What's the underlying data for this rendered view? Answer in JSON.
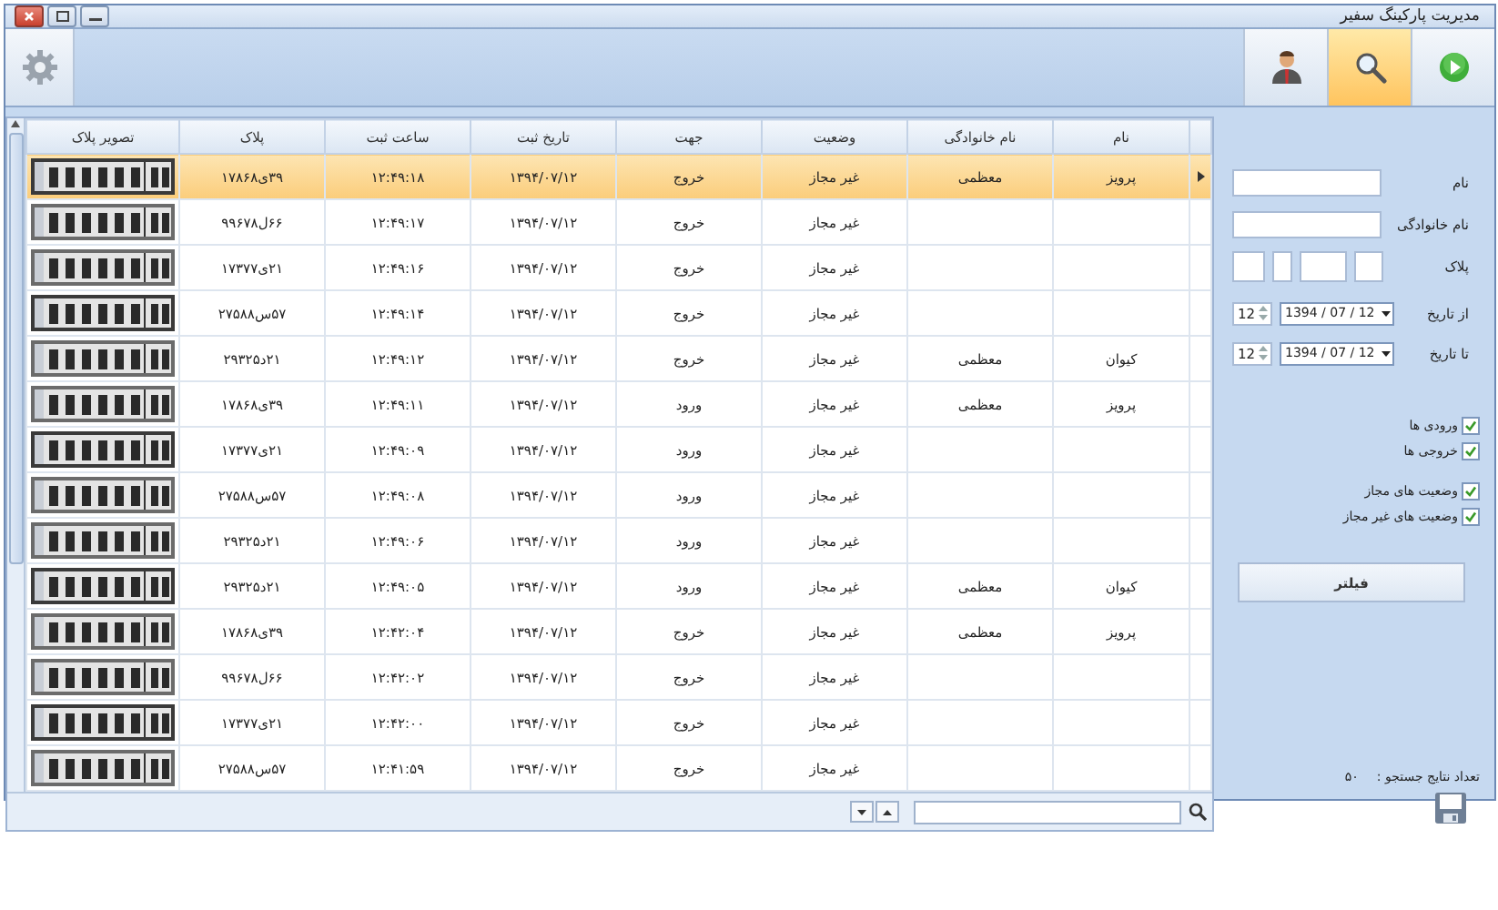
{
  "window": {
    "title": "مدیریت پارکینگ سفیر"
  },
  "toolbar": {
    "buttons": [
      {
        "kind": "play",
        "selected": false
      },
      {
        "kind": "search",
        "selected": true
      },
      {
        "kind": "user",
        "selected": false
      }
    ]
  },
  "table": {
    "columns": [
      "نام",
      "نام خانوادگی",
      "وضعیت",
      "جهت",
      "تاریخ ثبت",
      "ساعت ثبت",
      "پلاک",
      "تصویر پلاک"
    ],
    "rows": [
      {
        "selected": true,
        "cells": [
          "پرویز",
          "معظمی",
          "غیر مجاز",
          "خروج",
          "۱۳۹۴/۰۷/۱۲",
          "۱۲:۴۹:۱۸",
          "۳۹ی۱۷۸۶۸"
        ]
      },
      {
        "selected": false,
        "cells": [
          null,
          null,
          "غیر مجاز",
          "خروج",
          "۱۳۹۴/۰۷/۱۲",
          "۱۲:۴۹:۱۷",
          "۶۶ل۹۹۶۷۸"
        ]
      },
      {
        "selected": false,
        "cells": [
          null,
          null,
          "غیر مجاز",
          "خروج",
          "۱۳۹۴/۰۷/۱۲",
          "۱۲:۴۹:۱۶",
          "۲۱ی۱۷۳۷۷"
        ]
      },
      {
        "selected": false,
        "cells": [
          null,
          null,
          "غیر مجاز",
          "خروج",
          "۱۳۹۴/۰۷/۱۲",
          "۱۲:۴۹:۱۴",
          "۵۷س۲۷۵۸۸"
        ]
      },
      {
        "selected": false,
        "cells": [
          "کیوان",
          "معظمی",
          "غیر مجاز",
          "خروج",
          "۱۳۹۴/۰۷/۱۲",
          "۱۲:۴۹:۱۲",
          "۲۱د۲۹۳۲۵"
        ]
      },
      {
        "selected": false,
        "cells": [
          "پرویز",
          "معظمی",
          "غیر مجاز",
          "ورود",
          "۱۳۹۴/۰۷/۱۲",
          "۱۲:۴۹:۱۱",
          "۳۹ی۱۷۸۶۸"
        ]
      },
      {
        "selected": false,
        "cells": [
          null,
          null,
          "غیر مجاز",
          "ورود",
          "۱۳۹۴/۰۷/۱۲",
          "۱۲:۴۹:۰۹",
          "۲۱ی۱۷۳۷۷"
        ]
      },
      {
        "selected": false,
        "cells": [
          null,
          null,
          "غیر مجاز",
          "ورود",
          "۱۳۹۴/۰۷/۱۲",
          "۱۲:۴۹:۰۸",
          "۵۷س۲۷۵۸۸"
        ]
      },
      {
        "selected": false,
        "cells": [
          null,
          null,
          "غیر مجاز",
          "ورود",
          "۱۳۹۴/۰۷/۱۲",
          "۱۲:۴۹:۰۶",
          "۲۱د۲۹۳۲۵"
        ]
      },
      {
        "selected": false,
        "cells": [
          "کیوان",
          "معظمی",
          "غیر مجاز",
          "ورود",
          "۱۳۹۴/۰۷/۱۲",
          "۱۲:۴۹:۰۵",
          "۲۱د۲۹۳۲۵"
        ]
      },
      {
        "selected": false,
        "cells": [
          "پرویز",
          "معظمی",
          "غیر مجاز",
          "خروج",
          "۱۳۹۴/۰۷/۱۲",
          "۱۲:۴۲:۰۴",
          "۳۹ی۱۷۸۶۸"
        ]
      },
      {
        "selected": false,
        "cells": [
          null,
          null,
          "غیر مجاز",
          "خروج",
          "۱۳۹۴/۰۷/۱۲",
          "۱۲:۴۲:۰۲",
          "۶۶ل۹۹۶۷۸"
        ]
      },
      {
        "selected": false,
        "cells": [
          null,
          null,
          "غیر مجاز",
          "خروج",
          "۱۳۹۴/۰۷/۱۲",
          "۱۲:۴۲:۰۰",
          "۲۱ی۱۷۳۷۷"
        ]
      },
      {
        "selected": false,
        "cells": [
          null,
          null,
          "غیر مجاز",
          "خروج",
          "۱۳۹۴/۰۷/۱۲",
          "۱۲:۴۱:۵۹",
          "۵۷س۲۷۵۸۸"
        ]
      }
    ]
  },
  "filter": {
    "fields": [
      {
        "label": "نام"
      },
      {
        "label": "نام خانوادگی"
      }
    ],
    "plate_label": "پلاک",
    "date_ranges": [
      {
        "label": "از تاریخ",
        "date": "1394 / 07 / 12",
        "hour": "12"
      },
      {
        "label": "تا تاریخ",
        "date": "1394 / 07 / 12",
        "hour": "12"
      }
    ],
    "checkbox_groups": [
      [
        {
          "label": "ورودی ها",
          "checked": true
        },
        {
          "label": "خروجی ها",
          "checked": true
        }
      ],
      [
        {
          "label": "وضعیت های مجاز",
          "checked": true
        },
        {
          "label": "وضعیت های غیر مجاز",
          "checked": true
        }
      ]
    ],
    "button": "فیلتر",
    "result_label": "تعداد نتایج جستجو :",
    "result_count": "۵۰"
  }
}
